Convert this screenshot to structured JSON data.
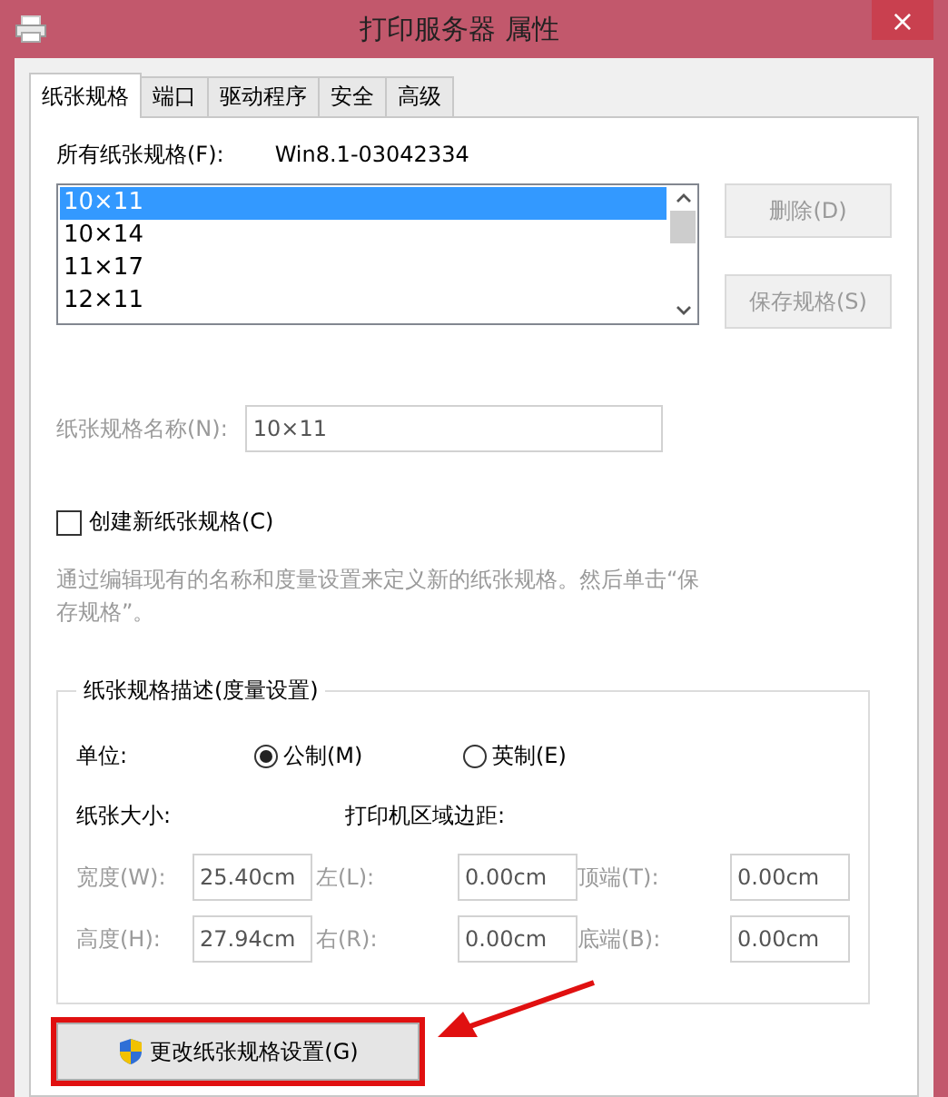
{
  "window": {
    "title": "打印服务器 属性",
    "close": "×"
  },
  "tabs": [
    {
      "label": "纸张规格",
      "selected": true
    },
    {
      "label": "端口",
      "selected": false
    },
    {
      "label": "驱动程序",
      "selected": false
    },
    {
      "label": "安全",
      "selected": false
    },
    {
      "label": "高级",
      "selected": false
    }
  ],
  "all_forms": {
    "label": "所有纸张规格(F):",
    "server": "Win8.1-03042334"
  },
  "forms_list": [
    {
      "label": "10×11",
      "selected": true
    },
    {
      "label": "10×14",
      "selected": false
    },
    {
      "label": "11×17",
      "selected": false
    },
    {
      "label": "12×11",
      "selected": false
    }
  ],
  "side_buttons": [
    {
      "label": "删除(D)",
      "disabled": true
    },
    {
      "label": "保存规格(S)",
      "disabled": true
    }
  ],
  "form_name": {
    "label": "纸张规格名称(N):",
    "value": "10×11",
    "disabled": true
  },
  "create_new": {
    "label": "创建新纸张规格(C)",
    "checked": false
  },
  "description": "通过编辑现有的名称和度量设置来定义新的纸张规格。然后单击“保存规格”。",
  "measurements": {
    "title": "纸张规格描述(度量设置)",
    "units_label": "单位:",
    "units": [
      {
        "label": "公制(M)",
        "selected": true
      },
      {
        "label": "英制(E)",
        "selected": false
      }
    ],
    "paper_size_label": "纸张大小:",
    "margins_label": "打印机区域边距:",
    "paper_size": [
      {
        "label": "宽度(W):",
        "value": "25.40cm"
      },
      {
        "label": "高度(H):",
        "value": "27.94cm"
      }
    ],
    "margins": [
      {
        "label": "左(L):",
        "value": "0.00cm"
      },
      {
        "label": "顶端(T):",
        "value": "0.00cm"
      },
      {
        "label": "右(R):",
        "value": "0.00cm"
      },
      {
        "label": "底端(B):",
        "value": "0.00cm"
      }
    ],
    "disabled": true
  },
  "change_button": {
    "label": "更改纸张规格设置(G)",
    "highlighted": true
  }
}
